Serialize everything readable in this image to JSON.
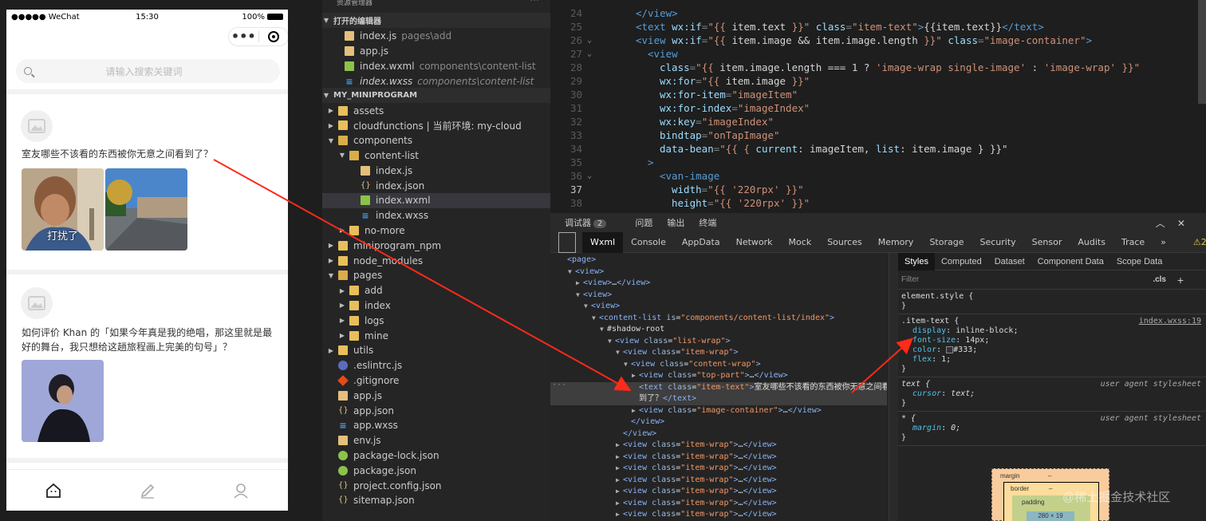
{
  "phone": {
    "carrier": "●●●●● WeChat",
    "time": "15:30",
    "battery": "100%",
    "search_placeholder": "请输入搜索关键词",
    "posts": [
      {
        "text": "室友哪些不该看的东西被你无意之间看到了？",
        "image_caption": "打扰了"
      },
      {
        "text": "如何评价 Khan 的「如果今年真是我的绝唱，那这里就是最好的舞台，我只想给这趟旅程画上完美的句号」？"
      }
    ],
    "tabs": [
      "home-icon",
      "edit-icon",
      "profile-icon"
    ]
  },
  "explorer": {
    "header": "资源管理器",
    "open_editors_label": "打开的编辑器",
    "open_editors": [
      {
        "name": "index.js",
        "path": "pages\\add",
        "icon": "js"
      },
      {
        "name": "app.js",
        "path": "",
        "icon": "js"
      },
      {
        "name": "index.wxml",
        "path": "components\\content-list",
        "icon": "wxml"
      },
      {
        "name": "index.wxss",
        "path": "components\\content-list",
        "icon": "wxss"
      }
    ],
    "project_label": "MY_MINIPROGRAM",
    "tree": [
      {
        "name": "assets",
        "depth": 1,
        "type": "folder",
        "arrow": "▶"
      },
      {
        "name": "cloudfunctions | 当前环境: my-cloud",
        "depth": 1,
        "type": "folder",
        "arrow": "▶"
      },
      {
        "name": "components",
        "depth": 1,
        "type": "folder",
        "arrow": "▼"
      },
      {
        "name": "content-list",
        "depth": 2,
        "type": "folder",
        "arrow": "▼"
      },
      {
        "name": "index.js",
        "depth": 3,
        "type": "js",
        "arrow": ""
      },
      {
        "name": "index.json",
        "depth": 3,
        "type": "json",
        "arrow": ""
      },
      {
        "name": "index.wxml",
        "depth": 3,
        "type": "wxml",
        "arrow": ""
      },
      {
        "name": "index.wxss",
        "depth": 3,
        "type": "wxss",
        "arrow": ""
      },
      {
        "name": "no-more",
        "depth": 2,
        "type": "folder",
        "arrow": "▶"
      },
      {
        "name": "miniprogram_npm",
        "depth": 1,
        "type": "folder",
        "arrow": "▶"
      },
      {
        "name": "node_modules",
        "depth": 1,
        "type": "folder",
        "arrow": "▶"
      },
      {
        "name": "pages",
        "depth": 1,
        "type": "folder",
        "arrow": "▼"
      },
      {
        "name": "add",
        "depth": 2,
        "type": "folder",
        "arrow": "▶"
      },
      {
        "name": "index",
        "depth": 2,
        "type": "folder",
        "arrow": "▶"
      },
      {
        "name": "logs",
        "depth": 2,
        "type": "folder",
        "arrow": "▶"
      },
      {
        "name": "mine",
        "depth": 2,
        "type": "folder",
        "arrow": "▶"
      },
      {
        "name": "utils",
        "depth": 1,
        "type": "folder",
        "arrow": "▶"
      },
      {
        "name": ".eslintrc.js",
        "depth": 1,
        "type": "circle",
        "arrow": ""
      },
      {
        "name": ".gitignore",
        "depth": 1,
        "type": "git",
        "arrow": ""
      },
      {
        "name": "app.js",
        "depth": 1,
        "type": "js",
        "arrow": ""
      },
      {
        "name": "app.json",
        "depth": 1,
        "type": "json",
        "arrow": ""
      },
      {
        "name": "app.wxss",
        "depth": 1,
        "type": "wxss",
        "arrow": ""
      },
      {
        "name": "env.js",
        "depth": 1,
        "type": "js",
        "arrow": ""
      },
      {
        "name": "package-lock.json",
        "depth": 1,
        "type": "npm",
        "arrow": ""
      },
      {
        "name": "package.json",
        "depth": 1,
        "type": "npm",
        "arrow": ""
      },
      {
        "name": "project.config.json",
        "depth": 1,
        "type": "json",
        "arrow": ""
      },
      {
        "name": "sitemap.json",
        "depth": 1,
        "type": "json",
        "arrow": ""
      }
    ],
    "selected": "index.wxml"
  },
  "editor": {
    "current_line": 37,
    "lines": [
      {
        "n": 24,
        "fold": "",
        "indent": 6,
        "tokens": [
          [
            "t",
            "</view>"
          ]
        ]
      },
      {
        "n": 25,
        "fold": "",
        "indent": 6,
        "tokens": [
          [
            "t",
            "<text "
          ],
          [
            "a",
            "wx:if"
          ],
          [
            "p",
            "="
          ],
          [
            "s",
            "\"{{ "
          ],
          [
            "tx",
            "item.text"
          ],
          [
            "s",
            " }}\""
          ],
          [
            "a",
            " class"
          ],
          [
            "p",
            "="
          ],
          [
            "s",
            "\"item-text\""
          ],
          [
            "t",
            ">"
          ],
          [
            "tx",
            "{{item.text}}"
          ],
          [
            "t",
            "</text>"
          ]
        ]
      },
      {
        "n": 26,
        "fold": "v",
        "indent": 6,
        "tokens": [
          [
            "t",
            "<view "
          ],
          [
            "a",
            "wx:if"
          ],
          [
            "p",
            "="
          ],
          [
            "s",
            "\"{{ "
          ],
          [
            "tx",
            "item.image && item.image.length"
          ],
          [
            "s",
            " }}\""
          ],
          [
            "a",
            " class"
          ],
          [
            "p",
            "="
          ],
          [
            "s",
            "\"image-container\""
          ],
          [
            "t",
            ">"
          ]
        ]
      },
      {
        "n": 27,
        "fold": "v",
        "indent": 8,
        "tokens": [
          [
            "t",
            "<view"
          ]
        ]
      },
      {
        "n": 28,
        "fold": "",
        "indent": 10,
        "tokens": [
          [
            "a",
            "class"
          ],
          [
            "p",
            "="
          ],
          [
            "s",
            "\"{{ "
          ],
          [
            "tx",
            "item.image.length === 1 ? "
          ],
          [
            "s",
            "'image-wrap single-image'"
          ],
          [
            "tx",
            " : "
          ],
          [
            "s",
            "'image-wrap'"
          ],
          [
            "s",
            " }}\""
          ]
        ]
      },
      {
        "n": 29,
        "fold": "",
        "indent": 10,
        "tokens": [
          [
            "a",
            "wx:for"
          ],
          [
            "p",
            "="
          ],
          [
            "s",
            "\"{{ "
          ],
          [
            "tx",
            "item.image"
          ],
          [
            "s",
            " }}\""
          ]
        ]
      },
      {
        "n": 30,
        "fold": "",
        "indent": 10,
        "tokens": [
          [
            "a",
            "wx:for-item"
          ],
          [
            "p",
            "="
          ],
          [
            "s",
            "\"imageItem\""
          ]
        ]
      },
      {
        "n": 31,
        "fold": "",
        "indent": 10,
        "tokens": [
          [
            "a",
            "wx:for-index"
          ],
          [
            "p",
            "="
          ],
          [
            "s",
            "\"imageIndex\""
          ]
        ]
      },
      {
        "n": 32,
        "fold": "",
        "indent": 10,
        "tokens": [
          [
            "a",
            "wx:key"
          ],
          [
            "p",
            "="
          ],
          [
            "s",
            "\"imageIndex\""
          ]
        ]
      },
      {
        "n": 33,
        "fold": "",
        "indent": 10,
        "tokens": [
          [
            "a",
            "bindtap"
          ],
          [
            "p",
            "="
          ],
          [
            "s",
            "\"onTapImage\""
          ]
        ]
      },
      {
        "n": 34,
        "fold": "",
        "indent": 10,
        "tokens": [
          [
            "a",
            "data-bean"
          ],
          [
            "p",
            "="
          ],
          [
            "s",
            "\"{{ { "
          ],
          [
            "a",
            "current"
          ],
          [
            "tx",
            ": imageItem, "
          ],
          [
            "a",
            "list"
          ],
          [
            "tx",
            ": item.image } }}\""
          ]
        ]
      },
      {
        "n": 35,
        "fold": "",
        "indent": 8,
        "tokens": [
          [
            "t",
            ">"
          ]
        ]
      },
      {
        "n": 36,
        "fold": "v",
        "indent": 10,
        "tokens": [
          [
            "t",
            "<van-image"
          ]
        ]
      },
      {
        "n": 37,
        "fold": "",
        "indent": 12,
        "tokens": [
          [
            "a",
            "width"
          ],
          [
            "p",
            "="
          ],
          [
            "s",
            "\"{{ "
          ],
          [
            "s",
            "'220rpx'"
          ],
          [
            "s",
            " }}\""
          ]
        ]
      },
      {
        "n": 38,
        "fold": "",
        "indent": 12,
        "tokens": [
          [
            "a",
            "height"
          ],
          [
            "p",
            "="
          ],
          [
            "s",
            "\"{{ "
          ],
          [
            "s",
            "'220rpx'"
          ],
          [
            "s",
            " }}\""
          ]
        ]
      }
    ]
  },
  "debugger": {
    "top_tabs": [
      {
        "label": "调试器",
        "badge": "2"
      },
      {
        "label": "问题"
      },
      {
        "label": "输出"
      },
      {
        "label": "终端"
      }
    ],
    "panel_tabs": [
      "Wxml",
      "Console",
      "AppData",
      "Network",
      "Mock",
      "Sources",
      "Memory",
      "Storage",
      "Security",
      "Sensor",
      "Audits",
      "Trace"
    ],
    "active_panel": "Wxml",
    "more": "»",
    "warn_count": "⚠2",
    "dom": [
      {
        "d": 0,
        "a": "",
        "html": [
          [
            "n",
            "<page>"
          ]
        ]
      },
      {
        "d": 1,
        "a": "▼",
        "html": [
          [
            "n",
            "<view>"
          ]
        ]
      },
      {
        "d": 2,
        "a": "▶",
        "html": [
          [
            "n",
            "<view>"
          ],
          [
            "w",
            "…"
          ],
          [
            "n",
            "</view>"
          ]
        ]
      },
      {
        "d": 2,
        "a": "▼",
        "html": [
          [
            "n",
            "<view>"
          ]
        ]
      },
      {
        "d": 3,
        "a": "▼",
        "html": [
          [
            "n",
            "<view>"
          ]
        ]
      },
      {
        "d": 4,
        "a": "▼",
        "html": [
          [
            "n",
            "<content-list "
          ],
          [
            "k",
            "is"
          ],
          [
            "w",
            "="
          ],
          [
            "v",
            "\"components/content-list/index\""
          ],
          [
            "n",
            ">"
          ]
        ]
      },
      {
        "d": 5,
        "a": "▼",
        "html": [
          [
            "w",
            "#shadow-root"
          ]
        ]
      },
      {
        "d": 6,
        "a": "▼",
        "html": [
          [
            "n",
            "<view "
          ],
          [
            "k",
            "class"
          ],
          [
            "w",
            "="
          ],
          [
            "v",
            "\"list-wrap\""
          ],
          [
            "n",
            ">"
          ]
        ]
      },
      {
        "d": 7,
        "a": "▼",
        "html": [
          [
            "n",
            "<view "
          ],
          [
            "k",
            "class"
          ],
          [
            "w",
            "="
          ],
          [
            "v",
            "\"item-wrap\""
          ],
          [
            "n",
            ">"
          ]
        ]
      },
      {
        "d": 8,
        "a": "▼",
        "html": [
          [
            "n",
            "<view "
          ],
          [
            "k",
            "class"
          ],
          [
            "w",
            "="
          ],
          [
            "v",
            "\"content-wrap\""
          ],
          [
            "n",
            ">"
          ]
        ]
      },
      {
        "d": 9,
        "a": "▶",
        "html": [
          [
            "n",
            "<view "
          ],
          [
            "k",
            "class"
          ],
          [
            "w",
            "="
          ],
          [
            "v",
            "\"top-part\""
          ],
          [
            "n",
            ">"
          ],
          [
            "w",
            "…"
          ],
          [
            "n",
            "</view>"
          ]
        ]
      },
      {
        "d": 9,
        "a": "",
        "hl": true,
        "html": [
          [
            "n",
            "<text "
          ],
          [
            "k",
            "class"
          ],
          [
            "w",
            "="
          ],
          [
            "v",
            "\"item-text\""
          ],
          [
            "n",
            ">"
          ],
          [
            "w",
            "室友哪些不该看的东西被你无意之间看"
          ]
        ]
      },
      {
        "d": 9,
        "a": "",
        "hl": true,
        "html": [
          [
            "w",
            "到了？"
          ],
          [
            "n",
            "</text>"
          ]
        ]
      },
      {
        "d": 9,
        "a": "▶",
        "html": [
          [
            "n",
            "<view "
          ],
          [
            "k",
            "class"
          ],
          [
            "w",
            "="
          ],
          [
            "v",
            "\"image-container\""
          ],
          [
            "n",
            ">"
          ],
          [
            "w",
            "…"
          ],
          [
            "n",
            "</view>"
          ]
        ]
      },
      {
        "d": 8,
        "a": "",
        "html": [
          [
            "n",
            "</view>"
          ]
        ]
      },
      {
        "d": 7,
        "a": "",
        "html": [
          [
            "n",
            "</view>"
          ]
        ]
      },
      {
        "d": 7,
        "a": "▶",
        "html": [
          [
            "n",
            "<view "
          ],
          [
            "k",
            "class"
          ],
          [
            "w",
            "="
          ],
          [
            "v",
            "\"item-wrap\""
          ],
          [
            "n",
            ">"
          ],
          [
            "w",
            "…"
          ],
          [
            "n",
            "</view>"
          ]
        ]
      },
      {
        "d": 7,
        "a": "▶",
        "html": [
          [
            "n",
            "<view "
          ],
          [
            "k",
            "class"
          ],
          [
            "w",
            "="
          ],
          [
            "v",
            "\"item-wrap\""
          ],
          [
            "n",
            ">"
          ],
          [
            "w",
            "…"
          ],
          [
            "n",
            "</view>"
          ]
        ]
      },
      {
        "d": 7,
        "a": "▶",
        "html": [
          [
            "n",
            "<view "
          ],
          [
            "k",
            "class"
          ],
          [
            "w",
            "="
          ],
          [
            "v",
            "\"item-wrap\""
          ],
          [
            "n",
            ">"
          ],
          [
            "w",
            "…"
          ],
          [
            "n",
            "</view>"
          ]
        ]
      },
      {
        "d": 7,
        "a": "▶",
        "html": [
          [
            "n",
            "<view "
          ],
          [
            "k",
            "class"
          ],
          [
            "w",
            "="
          ],
          [
            "v",
            "\"item-wrap\""
          ],
          [
            "n",
            ">"
          ],
          [
            "w",
            "…"
          ],
          [
            "n",
            "</view>"
          ]
        ]
      },
      {
        "d": 7,
        "a": "▶",
        "html": [
          [
            "n",
            "<view "
          ],
          [
            "k",
            "class"
          ],
          [
            "w",
            "="
          ],
          [
            "v",
            "\"item-wrap\""
          ],
          [
            "n",
            ">"
          ],
          [
            "w",
            "…"
          ],
          [
            "n",
            "</view>"
          ]
        ]
      },
      {
        "d": 7,
        "a": "▶",
        "html": [
          [
            "n",
            "<view "
          ],
          [
            "k",
            "class"
          ],
          [
            "w",
            "="
          ],
          [
            "v",
            "\"item-wrap\""
          ],
          [
            "n",
            ">"
          ],
          [
            "w",
            "…"
          ],
          [
            "n",
            "</view>"
          ]
        ]
      },
      {
        "d": 7,
        "a": "▶",
        "html": [
          [
            "n",
            "<view "
          ],
          [
            "k",
            "class"
          ],
          [
            "w",
            "="
          ],
          [
            "v",
            "\"item-wrap\""
          ],
          [
            "n",
            ">"
          ],
          [
            "w",
            "…"
          ],
          [
            "n",
            "</view>"
          ]
        ]
      }
    ],
    "styles_tabs": [
      "Styles",
      "Computed",
      "Dataset",
      "Component Data",
      "Scope Data"
    ],
    "filter_placeholder": "Filter",
    "cls": ".cls",
    "element_style": "element.style {",
    "rule": {
      "selector": ".item-text {",
      "source": "index.wxss:19",
      "props": [
        [
          "display",
          "inline-block;"
        ],
        [
          "font-size",
          "14px;"
        ],
        [
          "color",
          "#333;"
        ],
        [
          "flex",
          "1;"
        ]
      ]
    },
    "ua_text": {
      "selector": "text {",
      "label": "user agent stylesheet",
      "prop": [
        "cursor",
        "text;"
      ]
    },
    "ua_star": {
      "selector": "* {",
      "label": "user agent stylesheet",
      "prop": [
        "margin",
        "0;"
      ]
    },
    "boxmodel": {
      "margin": "margin",
      "border": "border",
      "padding": "padding",
      "content": "280 × 19",
      "dash": "–"
    }
  },
  "watermark": "@稀土掘金技术社区"
}
